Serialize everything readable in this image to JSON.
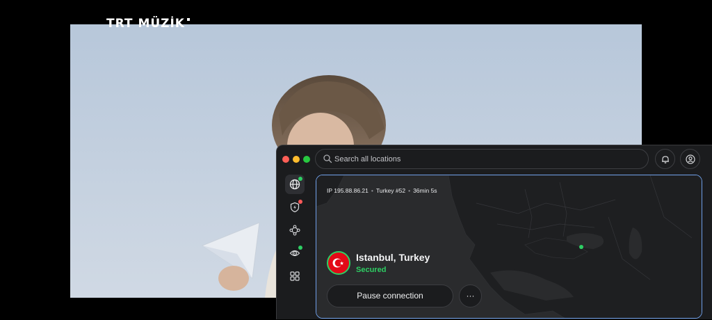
{
  "video": {
    "logo_text": "TRT MÜZİK"
  },
  "window": {
    "search": {
      "placeholder": "Search all locations",
      "value": ""
    },
    "top_buttons": {
      "bell_icon": "bell-icon",
      "profile_icon": "profile-icon"
    },
    "sidebar": [
      {
        "icon": "globe-icon",
        "badge_color": "#2ecf64",
        "active": true
      },
      {
        "icon": "shield-bolt-icon",
        "badge_color": "#ff5a5a",
        "active": false
      },
      {
        "icon": "meshnet-icon",
        "badge_color": "",
        "active": false
      },
      {
        "icon": "dark-web-monitor-icon",
        "badge_color": "#2ecf64",
        "active": false
      },
      {
        "icon": "apps-grid-icon",
        "badge_color": "",
        "active": false
      }
    ]
  },
  "connection": {
    "ip": "IP 195.88.86.21",
    "server": "Turkey #52",
    "duration": "36min 5s",
    "location": "Istanbul, Turkey",
    "status": "Secured",
    "pause_label": "Pause connection",
    "more_label": "···"
  },
  "colors": {
    "accent_blue": "#6f9fe8",
    "secured_green": "#2ecf64",
    "flag_red": "#e30a17"
  }
}
